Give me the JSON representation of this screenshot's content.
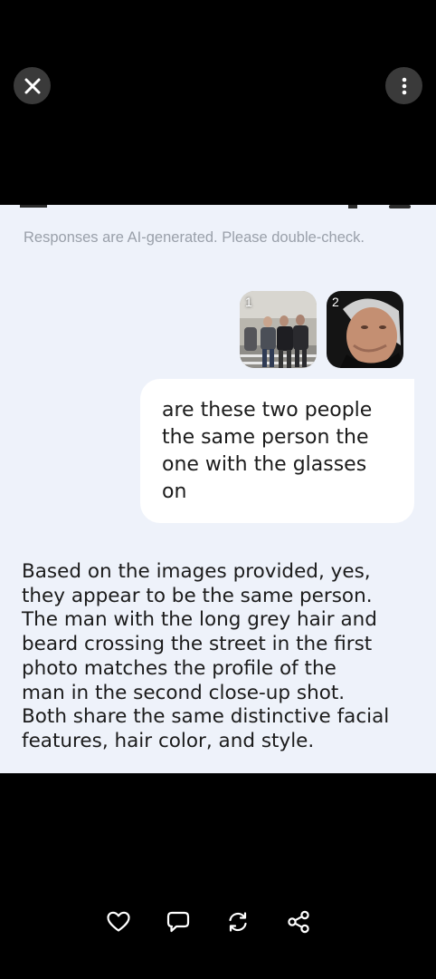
{
  "disclaimer": "Responses are AI-generated. Please double-check.",
  "attachments": [
    {
      "index": "1",
      "alt": "Street photo of men crossing"
    },
    {
      "index": "2",
      "alt": "Close-up portrait"
    }
  ],
  "user_message": "are these two people\nthe same person the\none with the glasses\non",
  "assistant_message": "Based on the images provided, yes,\nthey appear to be the same person.\nThe man with the long grey hair and\nbeard crossing the street in the first\nphoto matches the profile of the\nman in the second close-up shot.\nBoth share the same distinctive facial\nfeatures, hair color, and style.",
  "icons": {
    "close": "close-icon",
    "more": "more-vertical-icon",
    "like": "heart-icon",
    "comment": "comment-icon",
    "regenerate": "refresh-icon",
    "share": "share-icon"
  },
  "colors": {
    "background": "#000000",
    "panel": "#eef2fa",
    "bubble": "#ffffff",
    "disclaimer": "#9aa0aa"
  }
}
